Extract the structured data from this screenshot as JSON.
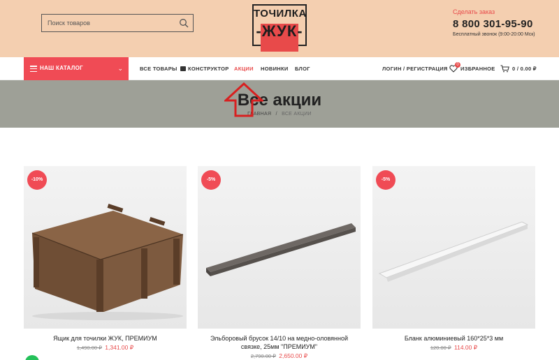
{
  "search": {
    "placeholder": "Поиск товаров",
    "icon": "search-icon"
  },
  "logo": {
    "line1": "ТОЧИЛКА",
    "line2": "-ЖУК-"
  },
  "contact": {
    "label": "Сделать заказ",
    "phone": "8 800 301-95-90",
    "note": "Бесплатный звонок (9:00-20:00 Мск)"
  },
  "nav": {
    "catalog_label": "НАШ КАТАЛОГ",
    "items": [
      {
        "label": "ВСЕ ТОВАРЫ"
      },
      {
        "label": "КОНСТРУКТОР"
      },
      {
        "label": "АКЦИИ"
      },
      {
        "label": "НОВИНКИ"
      },
      {
        "label": "БЛОГ"
      }
    ],
    "login": "ЛОГИН / РЕГИСТРАЦИЯ",
    "wishlist_label": "ИЗБРАННОЕ",
    "wishlist_count": "0",
    "cart": "0 / 0.00 ₽"
  },
  "hero": {
    "title": "Все акции",
    "breadcrumb_home": "ГЛАВНАЯ",
    "breadcrumb_sep": "/",
    "breadcrumb_current": "ВСЕ АКЦИИ"
  },
  "products": [
    {
      "badge": "-10%",
      "name": "Ящик для точилки ЖУК, ПРЕМИУМ",
      "old_price": "1,490.00 ₽",
      "price": "1,341.00 ₽"
    },
    {
      "badge": "-5%",
      "name_line1": "Эльборовый брусок 14/10 на медно-оловянной",
      "name_line2": "связке, 25мм \"ПРЕМИУМ\"",
      "old_price": "2,790.00 ₽",
      "price": "2,650.00 ₽"
    },
    {
      "badge": "-5%",
      "name": "Бланк алюминиевый 160*25*3 мм",
      "old_price": "120.00 ₽",
      "price": "114.00 ₽"
    }
  ],
  "colors": {
    "accent": "#f04b55",
    "topbar": "#f4cfb0",
    "hero": "#9ea097"
  }
}
